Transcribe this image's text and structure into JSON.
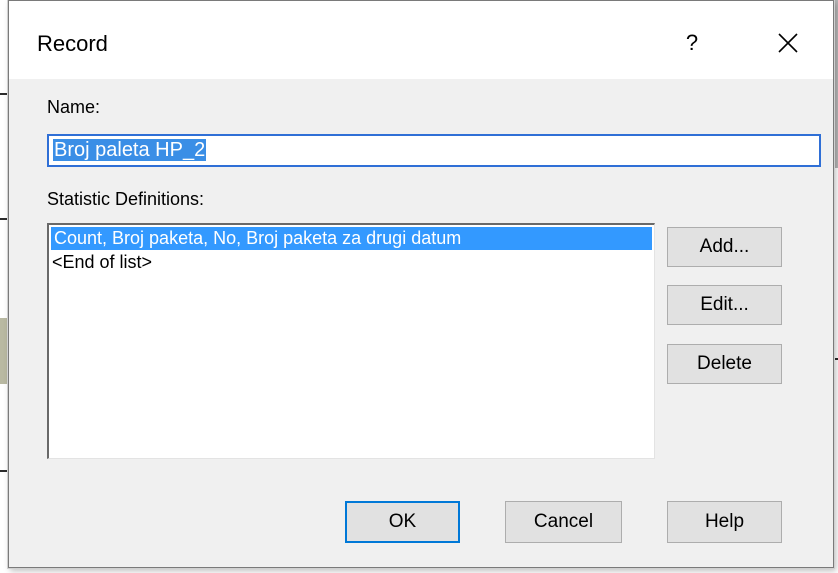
{
  "dialog": {
    "title": "Record",
    "help_glyph": "?",
    "close_glyph": "✕"
  },
  "form": {
    "name_label": "Name:",
    "name_value": "Broj paleta HP_2",
    "stat_label": "Statistic Definitions:"
  },
  "list": {
    "items": [
      "Count, Broj paketa, No, Broj paketa za drugi datum",
      "<End of list>"
    ],
    "selected_index": 0
  },
  "buttons": {
    "add": "Add...",
    "edit": "Edit...",
    "delete": "Delete",
    "ok": "OK",
    "cancel": "Cancel",
    "help": "Help"
  },
  "icons": {
    "close": "close-icon",
    "help": "help-icon"
  },
  "colors": {
    "selection": "#3399ff",
    "input_border": "#2f6fd6",
    "default_button_border": "#0078d7",
    "dialog_bg": "#f0f0f0"
  }
}
